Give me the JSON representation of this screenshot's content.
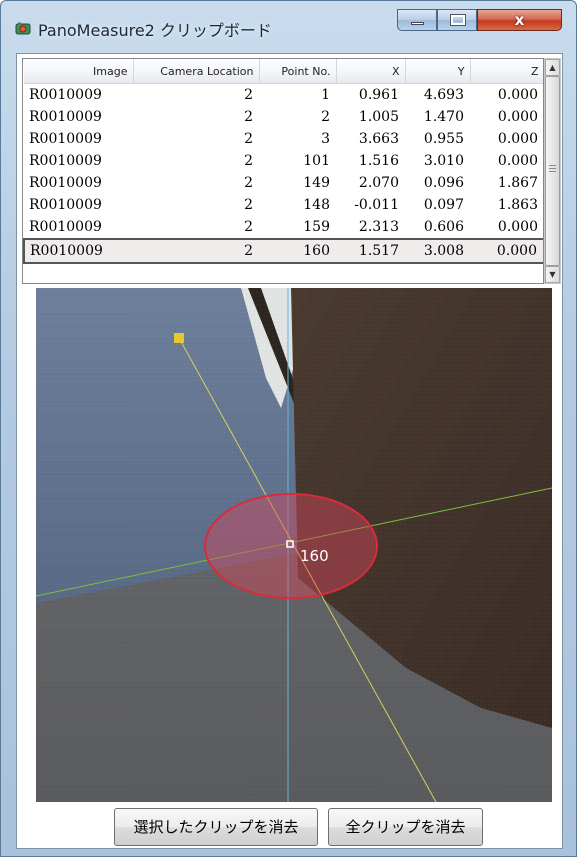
{
  "window": {
    "title": "PanoMeasure2 クリップボード",
    "close_glyph": "x"
  },
  "table": {
    "columns": [
      "Image",
      "Camera Location",
      "Point No.",
      "X",
      "Y",
      "Z"
    ],
    "rows": [
      [
        "R0010009",
        "2",
        "1",
        "0.961",
        "4.693",
        "0.000"
      ],
      [
        "R0010009",
        "2",
        "2",
        "1.005",
        "1.470",
        "0.000"
      ],
      [
        "R0010009",
        "2",
        "3",
        "3.663",
        "0.955",
        "0.000"
      ],
      [
        "R0010009",
        "2",
        "101",
        "1.516",
        "3.010",
        "0.000"
      ],
      [
        "R0010009",
        "2",
        "149",
        "2.070",
        "0.096",
        "1.867"
      ],
      [
        "R0010009",
        "2",
        "148",
        "-0.011",
        "0.097",
        "1.863"
      ],
      [
        "R0010009",
        "2",
        "159",
        "2.313",
        "0.606",
        "0.000"
      ],
      [
        "R0010009",
        "2",
        "160",
        "1.517",
        "3.008",
        "0.000"
      ]
    ],
    "selected_row": 7
  },
  "image": {
    "point_label": "160",
    "marker_color": "#e8c830",
    "ellipse_color": "#d92b3a",
    "line_colors": {
      "green": "#7fbf3a",
      "yellow": "#d9cf5a",
      "cyan": "#5fb8d8"
    }
  },
  "buttons": {
    "delete_selected": "選択したクリップを消去",
    "delete_all": "全クリップを消去"
  },
  "icons": {
    "app": "panorama-app-icon",
    "minimize": "minimize-icon",
    "maximize": "maximize-icon",
    "close": "close-icon",
    "scroll_up": "chevron-up-icon",
    "scroll_down": "chevron-down-icon"
  }
}
